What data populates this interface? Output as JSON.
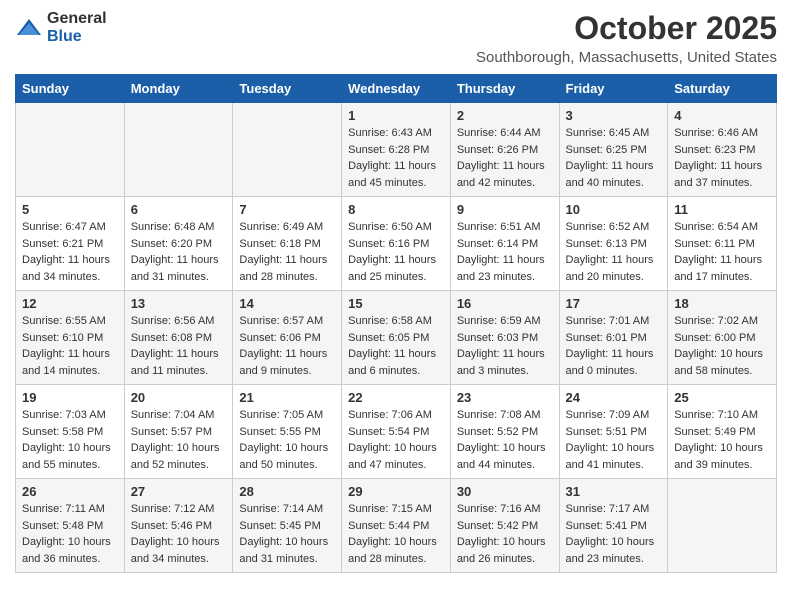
{
  "header": {
    "logo_general": "General",
    "logo_blue": "Blue",
    "month": "October 2025",
    "location": "Southborough, Massachusetts, United States"
  },
  "weekdays": [
    "Sunday",
    "Monday",
    "Tuesday",
    "Wednesday",
    "Thursday",
    "Friday",
    "Saturday"
  ],
  "weeks": [
    [
      {
        "day": "",
        "info": ""
      },
      {
        "day": "",
        "info": ""
      },
      {
        "day": "",
        "info": ""
      },
      {
        "day": "1",
        "info": "Sunrise: 6:43 AM\nSunset: 6:28 PM\nDaylight: 11 hours and 45 minutes."
      },
      {
        "day": "2",
        "info": "Sunrise: 6:44 AM\nSunset: 6:26 PM\nDaylight: 11 hours and 42 minutes."
      },
      {
        "day": "3",
        "info": "Sunrise: 6:45 AM\nSunset: 6:25 PM\nDaylight: 11 hours and 40 minutes."
      },
      {
        "day": "4",
        "info": "Sunrise: 6:46 AM\nSunset: 6:23 PM\nDaylight: 11 hours and 37 minutes."
      }
    ],
    [
      {
        "day": "5",
        "info": "Sunrise: 6:47 AM\nSunset: 6:21 PM\nDaylight: 11 hours and 34 minutes."
      },
      {
        "day": "6",
        "info": "Sunrise: 6:48 AM\nSunset: 6:20 PM\nDaylight: 11 hours and 31 minutes."
      },
      {
        "day": "7",
        "info": "Sunrise: 6:49 AM\nSunset: 6:18 PM\nDaylight: 11 hours and 28 minutes."
      },
      {
        "day": "8",
        "info": "Sunrise: 6:50 AM\nSunset: 6:16 PM\nDaylight: 11 hours and 25 minutes."
      },
      {
        "day": "9",
        "info": "Sunrise: 6:51 AM\nSunset: 6:14 PM\nDaylight: 11 hours and 23 minutes."
      },
      {
        "day": "10",
        "info": "Sunrise: 6:52 AM\nSunset: 6:13 PM\nDaylight: 11 hours and 20 minutes."
      },
      {
        "day": "11",
        "info": "Sunrise: 6:54 AM\nSunset: 6:11 PM\nDaylight: 11 hours and 17 minutes."
      }
    ],
    [
      {
        "day": "12",
        "info": "Sunrise: 6:55 AM\nSunset: 6:10 PM\nDaylight: 11 hours and 14 minutes."
      },
      {
        "day": "13",
        "info": "Sunrise: 6:56 AM\nSunset: 6:08 PM\nDaylight: 11 hours and 11 minutes."
      },
      {
        "day": "14",
        "info": "Sunrise: 6:57 AM\nSunset: 6:06 PM\nDaylight: 11 hours and 9 minutes."
      },
      {
        "day": "15",
        "info": "Sunrise: 6:58 AM\nSunset: 6:05 PM\nDaylight: 11 hours and 6 minutes."
      },
      {
        "day": "16",
        "info": "Sunrise: 6:59 AM\nSunset: 6:03 PM\nDaylight: 11 hours and 3 minutes."
      },
      {
        "day": "17",
        "info": "Sunrise: 7:01 AM\nSunset: 6:01 PM\nDaylight: 11 hours and 0 minutes."
      },
      {
        "day": "18",
        "info": "Sunrise: 7:02 AM\nSunset: 6:00 PM\nDaylight: 10 hours and 58 minutes."
      }
    ],
    [
      {
        "day": "19",
        "info": "Sunrise: 7:03 AM\nSunset: 5:58 PM\nDaylight: 10 hours and 55 minutes."
      },
      {
        "day": "20",
        "info": "Sunrise: 7:04 AM\nSunset: 5:57 PM\nDaylight: 10 hours and 52 minutes."
      },
      {
        "day": "21",
        "info": "Sunrise: 7:05 AM\nSunset: 5:55 PM\nDaylight: 10 hours and 50 minutes."
      },
      {
        "day": "22",
        "info": "Sunrise: 7:06 AM\nSunset: 5:54 PM\nDaylight: 10 hours and 47 minutes."
      },
      {
        "day": "23",
        "info": "Sunrise: 7:08 AM\nSunset: 5:52 PM\nDaylight: 10 hours and 44 minutes."
      },
      {
        "day": "24",
        "info": "Sunrise: 7:09 AM\nSunset: 5:51 PM\nDaylight: 10 hours and 41 minutes."
      },
      {
        "day": "25",
        "info": "Sunrise: 7:10 AM\nSunset: 5:49 PM\nDaylight: 10 hours and 39 minutes."
      }
    ],
    [
      {
        "day": "26",
        "info": "Sunrise: 7:11 AM\nSunset: 5:48 PM\nDaylight: 10 hours and 36 minutes."
      },
      {
        "day": "27",
        "info": "Sunrise: 7:12 AM\nSunset: 5:46 PM\nDaylight: 10 hours and 34 minutes."
      },
      {
        "day": "28",
        "info": "Sunrise: 7:14 AM\nSunset: 5:45 PM\nDaylight: 10 hours and 31 minutes."
      },
      {
        "day": "29",
        "info": "Sunrise: 7:15 AM\nSunset: 5:44 PM\nDaylight: 10 hours and 28 minutes."
      },
      {
        "day": "30",
        "info": "Sunrise: 7:16 AM\nSunset: 5:42 PM\nDaylight: 10 hours and 26 minutes."
      },
      {
        "day": "31",
        "info": "Sunrise: 7:17 AM\nSunset: 5:41 PM\nDaylight: 10 hours and 23 minutes."
      },
      {
        "day": "",
        "info": ""
      }
    ]
  ]
}
